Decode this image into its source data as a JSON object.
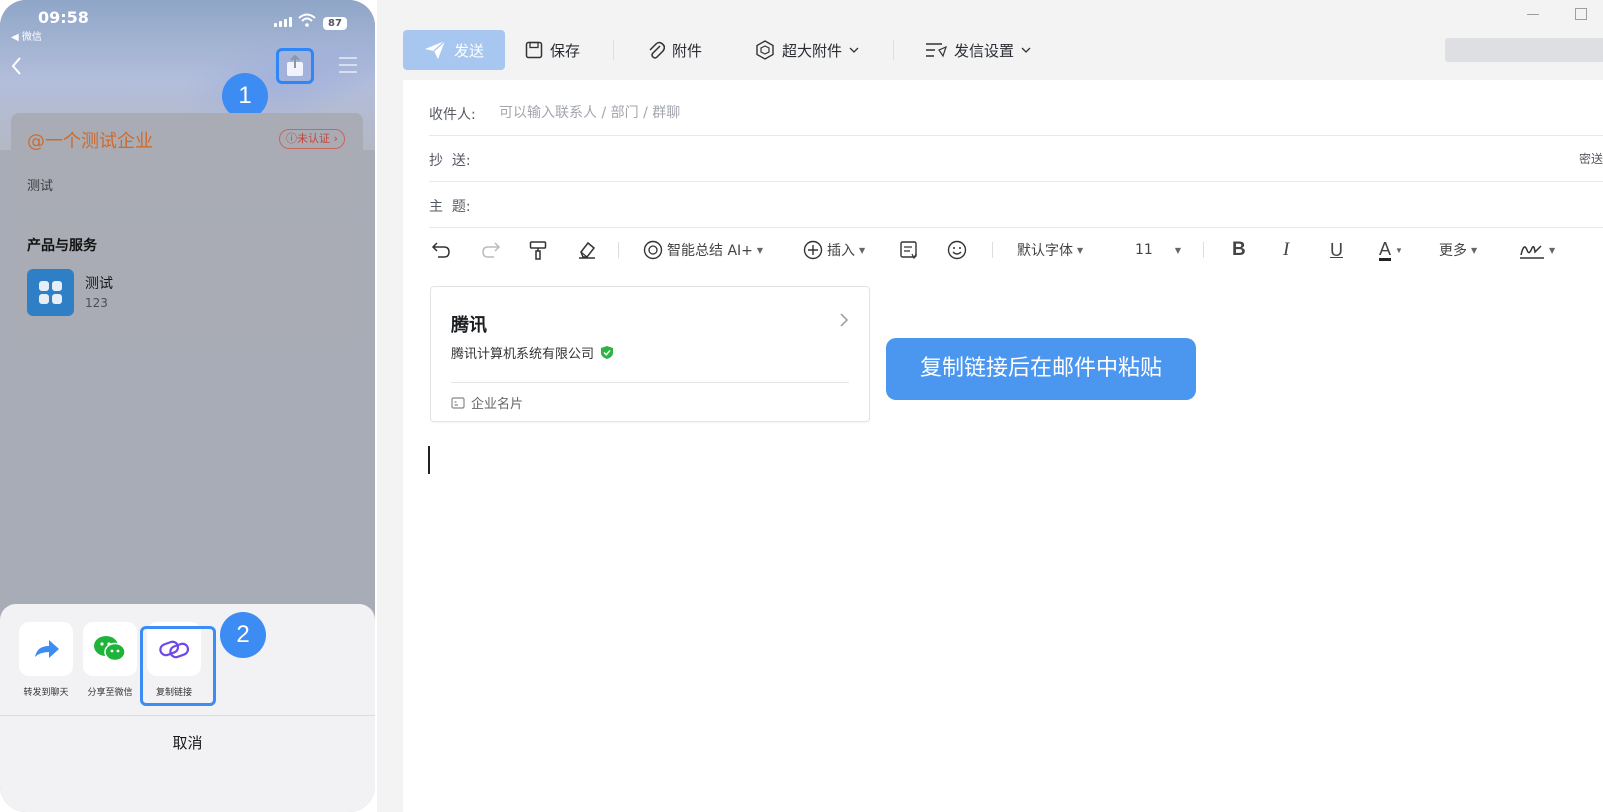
{
  "phone": {
    "status": {
      "time": "09:58",
      "back_app": "◀ 微信",
      "battery": "87"
    },
    "step1": "1",
    "step2": "2",
    "enterprise": {
      "name": "@一个测试企业",
      "badge": "未认证",
      "desc": "测试"
    },
    "products": {
      "title": "产品与服务",
      "item_name": "测试",
      "item_sub": "123"
    },
    "share_sheet": {
      "options": [
        {
          "label": "转发到聊天",
          "icon": "forward-icon"
        },
        {
          "label": "分享至微信",
          "icon": "wechat-icon"
        },
        {
          "label": "复制链接",
          "icon": "link-icon"
        }
      ],
      "cancel": "取消"
    }
  },
  "email": {
    "toolbar": {
      "send": "发送",
      "save": "保存",
      "attachment": "附件",
      "large_attachment": "超大附件",
      "send_settings": "发信设置"
    },
    "fields": {
      "to_label": "收件人:",
      "to_placeholder": "可以输入联系人 / 部门 / 群聊",
      "cc_label": "抄  送:",
      "bcc": "密送",
      "subject_label": "主  题:"
    },
    "format": {
      "ai_summary": "智能总结 AI+",
      "insert": "插入",
      "font": "默认字体",
      "size": "11",
      "bold": "B",
      "italic": "I",
      "underline": "U",
      "color": "A",
      "more": "更多"
    },
    "card": {
      "name": "腾讯",
      "company": "腾讯计算机系统有限公司",
      "footer": "企业名片"
    },
    "tooltip": "复制链接后在邮件中粘贴"
  },
  "colors": {
    "accent": "#3d8cf3",
    "send_button": "#a7c7f0",
    "enterprise_title": "#d06a2b",
    "verified": "#2fb344"
  }
}
